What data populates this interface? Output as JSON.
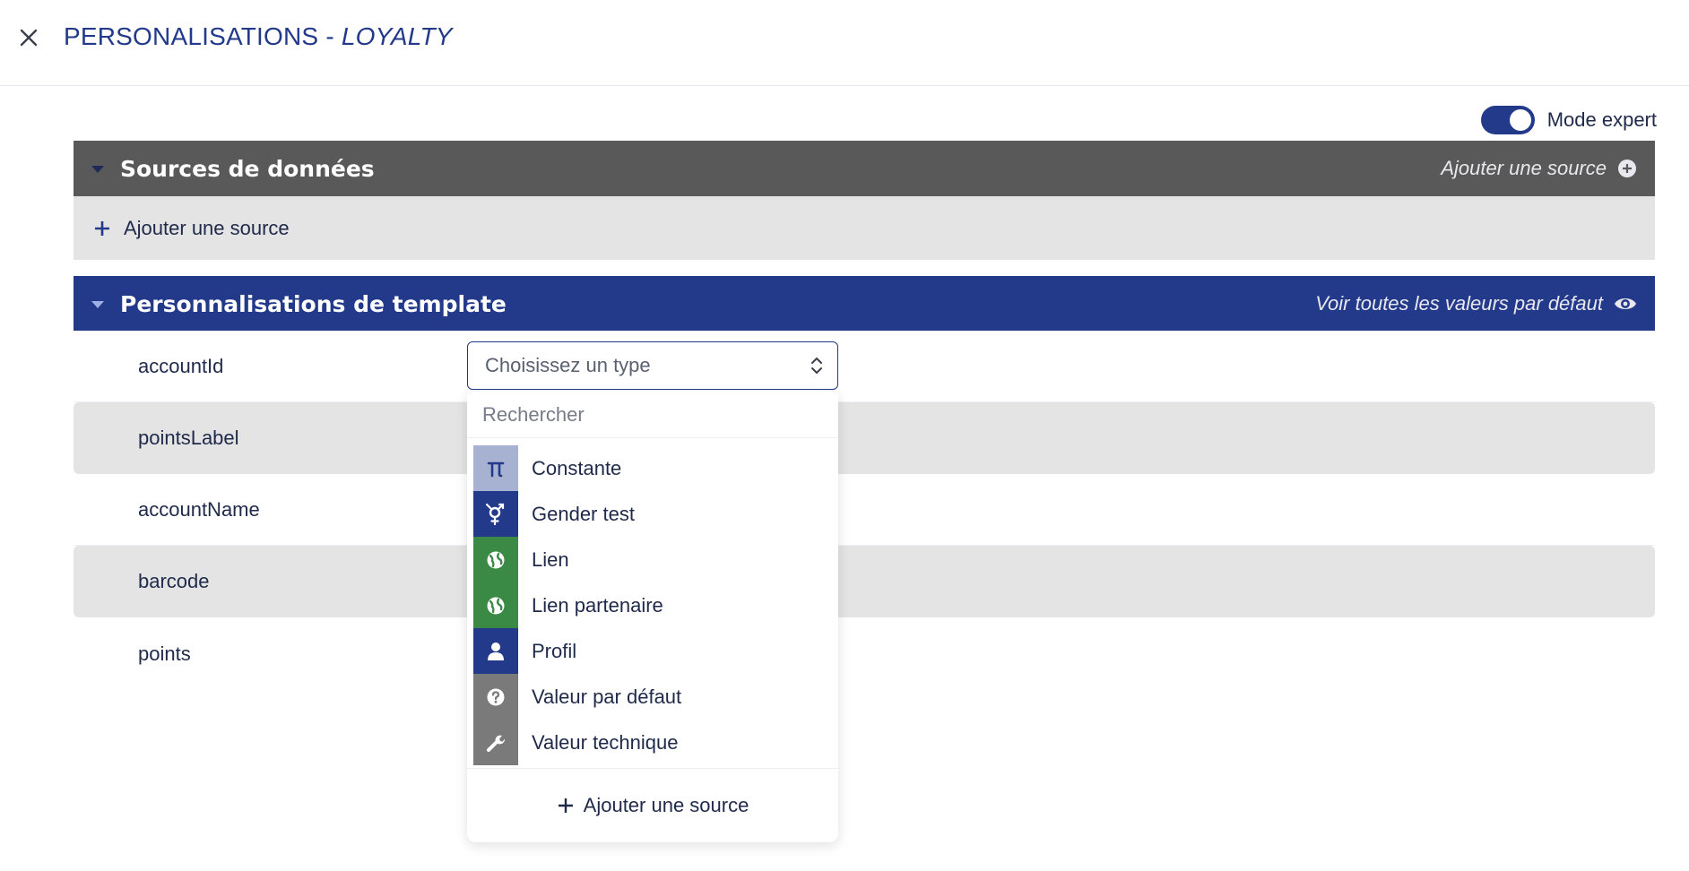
{
  "header": {
    "title_main": "PERSONALISATIONS",
    "title_separator": "-",
    "title_italic": "LOYALTY"
  },
  "expert_mode": {
    "label": "Mode expert",
    "enabled": true
  },
  "sources_section": {
    "title": "Sources de données",
    "header_action": "Ajouter une source",
    "add_row_label": "Ajouter une source"
  },
  "template_section": {
    "title": "Personnalisations de template",
    "header_action": "Voir toutes les valeurs par défaut",
    "fields": [
      "accountId",
      "pointsLabel",
      "accountName",
      "barcode",
      "points"
    ]
  },
  "type_select": {
    "placeholder": "Choisissez un type",
    "search_placeholder": "Rechercher",
    "options": [
      {
        "label": "Constante",
        "icon": "pi-icon",
        "color": "#a7b1d2"
      },
      {
        "label": "Gender test",
        "icon": "gender-icon",
        "color": "#23398a"
      },
      {
        "label": "Lien",
        "icon": "globe-icon",
        "color": "#3a8a45"
      },
      {
        "label": "Lien partenaire",
        "icon": "globe-icon",
        "color": "#3a8a45"
      },
      {
        "label": "Profil",
        "icon": "person-icon",
        "color": "#23398a"
      },
      {
        "label": "Valeur par défaut",
        "icon": "question-circle-icon",
        "color": "#7a7a7a"
      },
      {
        "label": "Valeur technique",
        "icon": "wrench-icon",
        "color": "#7a7a7a"
      }
    ],
    "footer_label": "Ajouter une source"
  },
  "colors": {
    "primary": "#23398a",
    "section_dark": "#595959",
    "row_alt": "#e4e4e4"
  }
}
